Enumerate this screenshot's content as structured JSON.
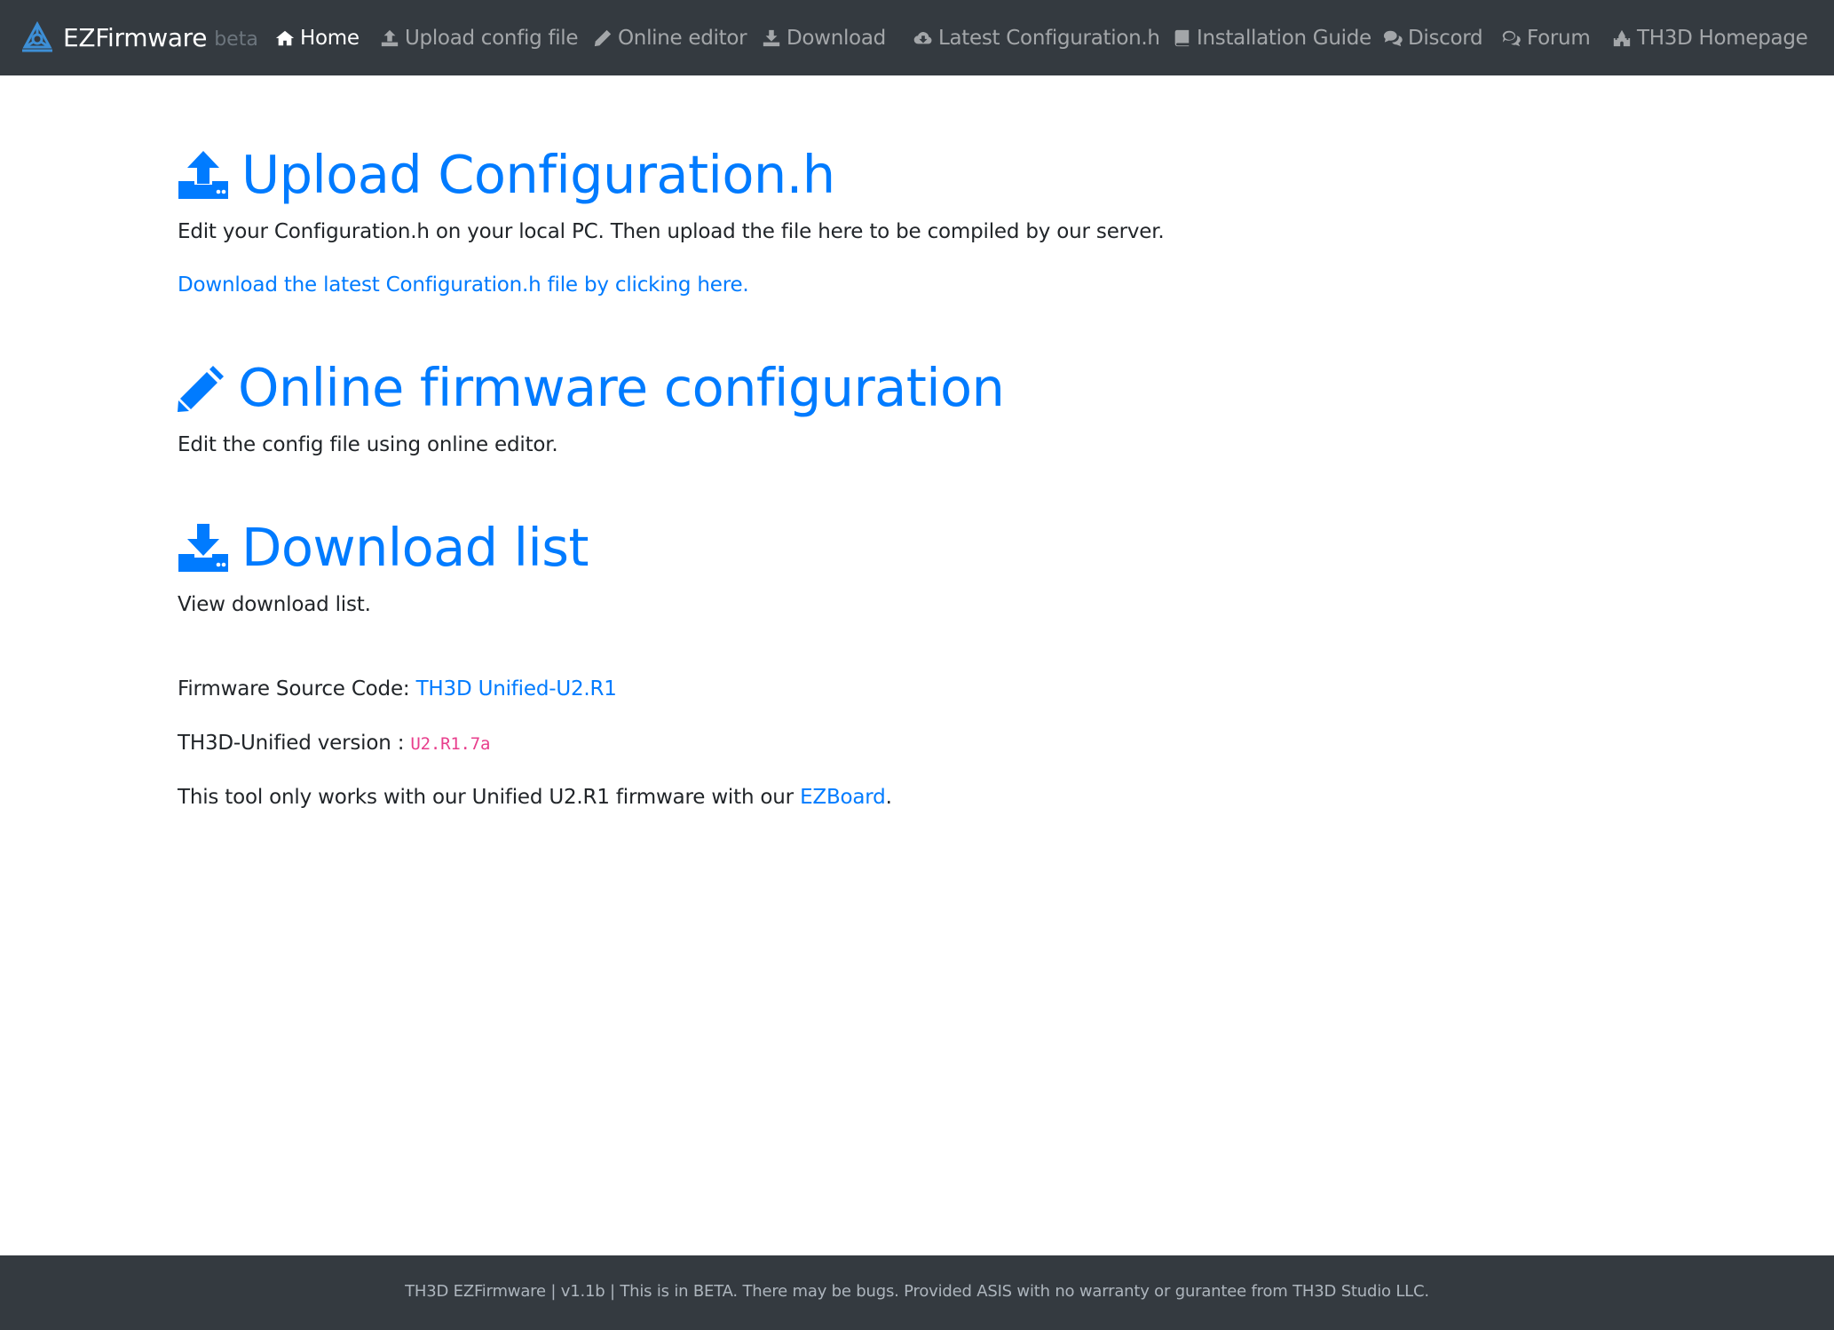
{
  "navbar": {
    "brand_name": "EZFirmware",
    "brand_tag": "beta",
    "items": [
      {
        "label": "Home",
        "icon": "home-icon"
      },
      {
        "label": "Upload config file",
        "icon": "upload-icon"
      },
      {
        "label": "Online editor",
        "icon": "pencil-icon"
      },
      {
        "label": "Download",
        "icon": "download-icon"
      },
      {
        "label": "Latest Configuration.h",
        "icon": "cloud-download-icon"
      },
      {
        "label": "Installation Guide",
        "icon": "book-icon"
      },
      {
        "label": "Discord",
        "icon": "comments-icon"
      },
      {
        "label": "Forum",
        "icon": "comment-bubbles-icon"
      },
      {
        "label": "TH3D Homepage",
        "icon": "castle-icon"
      }
    ]
  },
  "upload_section": {
    "title": "Upload Configuration.h",
    "description": "Edit your Configuration.h on your local PC. Then upload the file here to be compiled by our server.",
    "link_text": "Download the latest Configuration.h file by clicking here."
  },
  "editor_section": {
    "title": "Online firmware configuration",
    "description": "Edit the config file using online editor."
  },
  "download_section": {
    "title": "Download list",
    "description": "View download list."
  },
  "info": {
    "source_label": "Firmware Source Code: ",
    "source_link": "TH3D Unified-U2.R1",
    "version_label": "TH3D-Unified version : ",
    "version_value": "U2.R1.7a",
    "note_prefix": "This tool only works with our Unified U2.R1 firmware with our ",
    "note_link": "EZBoard",
    "note_suffix": "."
  },
  "footer": {
    "text": "TH3D EZFirmware | v1.1b | This is in BETA. There may be bugs. Provided ASIS with no warranty or gurantee from TH3D Studio LLC."
  },
  "colors": {
    "navbar_bg": "#343a40",
    "accent": "#007bff",
    "code": "#e83e8c"
  }
}
